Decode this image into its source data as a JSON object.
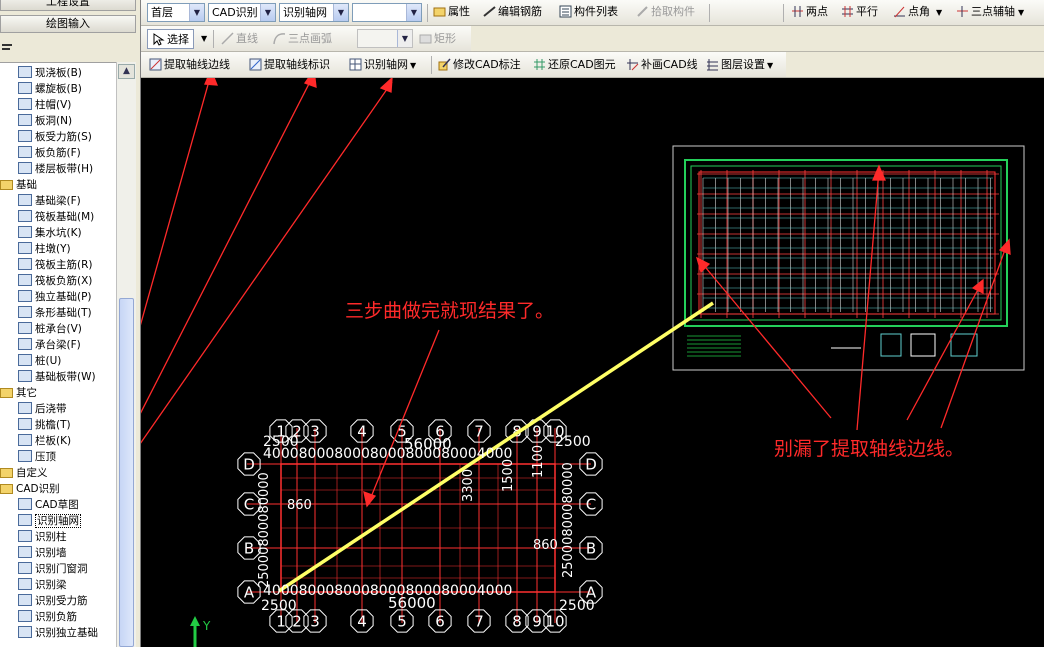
{
  "left_panel": {
    "top_button": "工程设置",
    "second_button": "绘图输入",
    "tree_items": [
      {
        "label": "现浇板(B)",
        "type": "item",
        "icon": "slab-icon"
      },
      {
        "label": "螺旋板(B)",
        "type": "item",
        "icon": "spiral-slab-icon"
      },
      {
        "label": "柱帽(V)",
        "type": "item",
        "icon": "column-cap-icon"
      },
      {
        "label": "板洞(N)",
        "type": "item",
        "icon": "slab-hole-icon"
      },
      {
        "label": "板受力筋(S)",
        "type": "item",
        "icon": "slab-rebar-icon"
      },
      {
        "label": "板负筋(F)",
        "type": "item",
        "icon": "slab-neg-rebar-icon"
      },
      {
        "label": "楼层板带(H)",
        "type": "item",
        "icon": "floor-strip-icon"
      },
      {
        "label": "基础",
        "type": "group",
        "icon": "folder-icon"
      },
      {
        "label": "基础梁(F)",
        "type": "item",
        "icon": "foundation-beam-icon"
      },
      {
        "label": "筏板基础(M)",
        "type": "item",
        "icon": "raft-foundation-icon"
      },
      {
        "label": "集水坑(K)",
        "type": "item",
        "icon": "sump-pit-icon"
      },
      {
        "label": "柱墩(Y)",
        "type": "item",
        "icon": "column-pier-icon"
      },
      {
        "label": "筏板主筋(R)",
        "type": "item",
        "icon": "raft-main-rebar-icon"
      },
      {
        "label": "筏板负筋(X)",
        "type": "item",
        "icon": "raft-neg-rebar-icon"
      },
      {
        "label": "独立基础(P)",
        "type": "item",
        "icon": "isolated-foundation-icon"
      },
      {
        "label": "条形基础(T)",
        "type": "item",
        "icon": "strip-foundation-icon"
      },
      {
        "label": "桩承台(V)",
        "type": "item",
        "icon": "pile-cap-icon"
      },
      {
        "label": "承台梁(F)",
        "type": "item",
        "icon": "cap-beam-icon"
      },
      {
        "label": "桩(U)",
        "type": "item",
        "icon": "pile-icon"
      },
      {
        "label": "基础板带(W)",
        "type": "item",
        "icon": "foundation-strip-icon"
      },
      {
        "label": "其它",
        "type": "group",
        "icon": "folder-icon"
      },
      {
        "label": "后浇带",
        "type": "item",
        "icon": "post-cast-strip-icon"
      },
      {
        "label": "挑檐(T)",
        "type": "item",
        "icon": "eave-icon"
      },
      {
        "label": "栏板(K)",
        "type": "item",
        "icon": "parapet-icon"
      },
      {
        "label": "压顶",
        "type": "item",
        "icon": "coping-icon"
      },
      {
        "label": "自定义",
        "type": "group",
        "icon": "folder-icon"
      },
      {
        "label": "CAD识别",
        "type": "group",
        "icon": "folder-icon"
      },
      {
        "label": "CAD草图",
        "type": "item",
        "icon": "cad-sketch-icon"
      },
      {
        "label": "识别轴网",
        "type": "item",
        "icon": "gear-icon",
        "selected": true
      },
      {
        "label": "识别柱",
        "type": "item",
        "icon": "recognize-column-icon"
      },
      {
        "label": "识别墙",
        "type": "item",
        "icon": "recognize-wall-icon"
      },
      {
        "label": "识别门窗洞",
        "type": "item",
        "icon": "recognize-opening-icon"
      },
      {
        "label": "识别梁",
        "type": "item",
        "icon": "recognize-beam-icon"
      },
      {
        "label": "识别受力筋",
        "type": "item",
        "icon": "recognize-rebar-icon"
      },
      {
        "label": "识别负筋",
        "type": "item",
        "icon": "recognize-neg-rebar-icon"
      },
      {
        "label": "识别独立基础",
        "type": "item",
        "icon": "recognize-foundation-icon"
      }
    ]
  },
  "toolbar1": {
    "floor_value": "首层",
    "mode_value": "CAD识别",
    "target_value": "识别轴网",
    "blank_value": "",
    "properties": "属性",
    "edit_rebar": "编辑钢筋",
    "component_list": "构件列表",
    "pick_component": "拾取构件",
    "two_point": "两点",
    "parallel": "平行",
    "point_angle": "点角",
    "three_point_aux": "三点辅轴"
  },
  "toolbar2": {
    "select": "选择",
    "line": "直线",
    "three_point_arc": "三点画弧",
    "rectangle": "矩形"
  },
  "toolbar3": {
    "extract_axis_edge": "提取轴线边线",
    "extract_axis_label": "提取轴线标识",
    "recognize_grid": "识别轴网",
    "modify_cad_label": "修改CAD标注",
    "restore_cad": "还原CAD图元",
    "redraw_cad_line": "补画CAD线",
    "layer_settings": "图层设置"
  },
  "annotations": {
    "three_steps": "三步曲做完就现结果了。",
    "dont_miss": "别漏了提取轴线边线。"
  },
  "grid": {
    "top_numbers": [
      "1",
      "2",
      "3",
      "4",
      "5",
      "6",
      "7",
      "8",
      "9",
      "10"
    ],
    "side_letters": [
      "D",
      "C",
      "B",
      "A"
    ],
    "top_dim": "56000",
    "bottom_dim": "56000",
    "left_top_dim": "2500",
    "right_top_dim": "2500",
    "left_bottom_dim": "2500",
    "right_bottom_dim": "2500",
    "top_span_text": "4000800080008000800080004000",
    "bottom_span_text": "4000800080008000800080004000",
    "mid_dim_1": "3300",
    "mid_dim_2": "1500",
    "mid_dim_3": "860",
    "mid_dim_4": "860",
    "mid_dim_5": "1100",
    "left_vert_text": "25000800080000",
    "right_vert_text": "25000800080000"
  },
  "ucs": {
    "y_label": "Y"
  },
  "colors": {
    "red": "#ff2a2a",
    "yellow": "#ffff66",
    "cad_white": "#ffffff",
    "grid_red": "#ff3030"
  }
}
